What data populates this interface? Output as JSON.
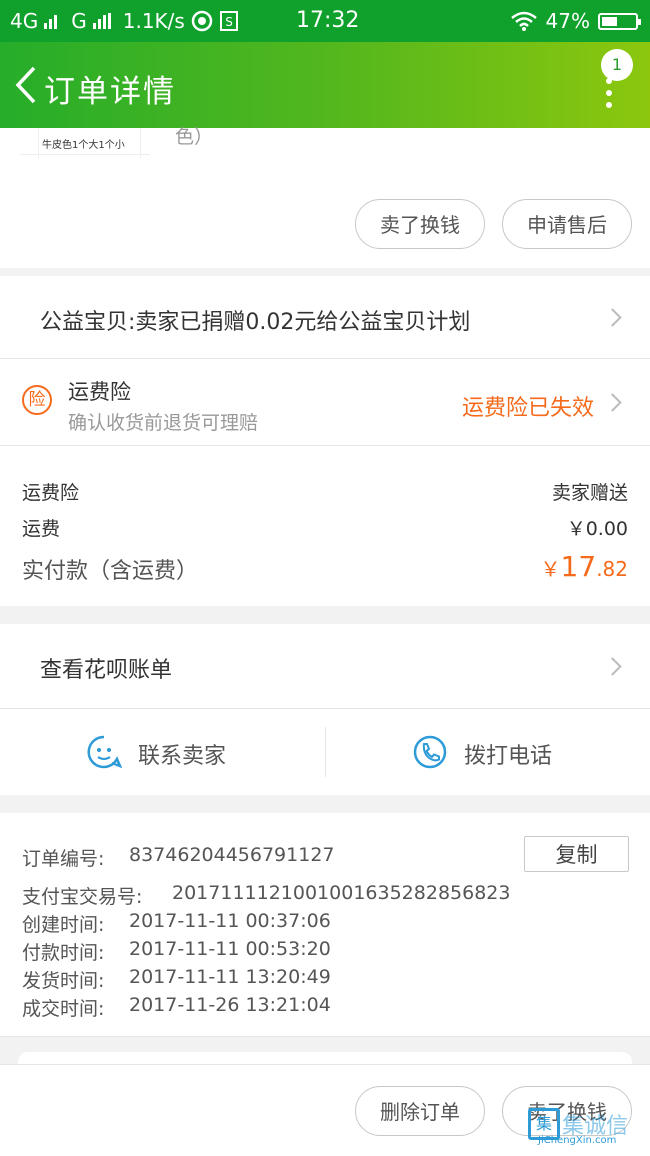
{
  "status_bar": {
    "network_1": "4G",
    "network_2": "G",
    "speed": "1.1K/s",
    "time": "17:32",
    "battery": "47%",
    "battery_level": 0.47
  },
  "header": {
    "title": "订单详情",
    "badge": "1"
  },
  "product": {
    "thumbnail_text": "牛皮色1个大1个小",
    "spec_fragment": "色）",
    "sell_button": "卖了换钱",
    "after_sale_button": "申请售后"
  },
  "charity": {
    "text": "公益宝贝:卖家已捐赠0.02元给公益宝贝计划"
  },
  "insurance": {
    "icon_char": "险",
    "title": "运费险",
    "subtitle": "确认收货前退货可理赔",
    "status": "运费险已失效"
  },
  "costs": {
    "insurance_label": "运费险",
    "insurance_value": "卖家赠送",
    "shipping_label": "运费",
    "shipping_value": "￥0.00",
    "paid_label": "实付款（含运费）",
    "paid_symbol": "￥",
    "paid_int": "17",
    "paid_dec": ".82"
  },
  "huabei": {
    "text": "查看花呗账单"
  },
  "contact": {
    "seller_label": "联系卖家",
    "phone_label": "拨打电话"
  },
  "order_info": {
    "copy_button": "复制",
    "rows": [
      {
        "label": "订单编号:",
        "value": "83746204456791127"
      },
      {
        "label": "支付宝交易号:",
        "value": "2017111121001001635282856823"
      },
      {
        "label": "创建时间:",
        "value": "2017-11-11 00:37:06"
      },
      {
        "label": "付款时间:",
        "value": "2017-11-11 00:53:20"
      },
      {
        "label": "发货时间:",
        "value": "2017-11-11 13:20:49"
      },
      {
        "label": "成交时间:",
        "value": "2017-11-26 13:21:04"
      }
    ]
  },
  "footer": {
    "delete_button": "删除订单",
    "sell_button": "卖了换钱"
  },
  "watermark": {
    "brand": "JiChengXin.com",
    "chars": "集诚信"
  },
  "colors": {
    "status_bar": "#0fa12c",
    "accent_orange": "#f56a1b",
    "icon_blue": "#2d9bd8"
  }
}
